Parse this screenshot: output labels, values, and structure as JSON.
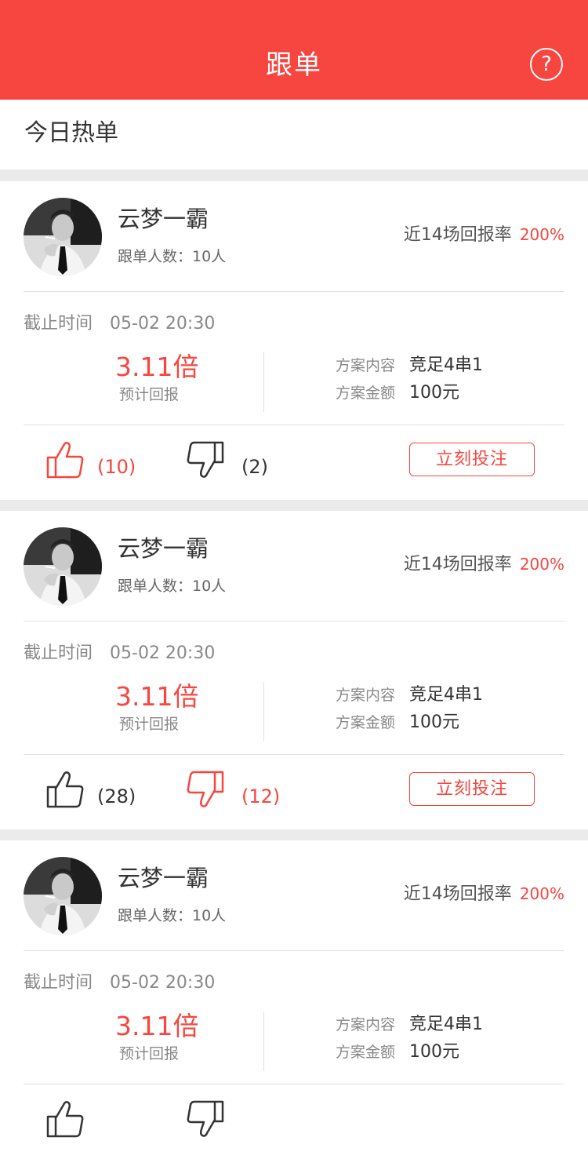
{
  "header": {
    "title": "跟单",
    "help_icon_text": "?"
  },
  "section": {
    "title": "今日热单"
  },
  "cards": [
    {
      "name": "云梦一霸",
      "followers": "跟单人数：10人",
      "rate_label": "近14场回报率",
      "rate_value": "200%",
      "deadline_label": "截止时间",
      "deadline_value": "05-02 20:30",
      "odds": "3.11倍",
      "odds_label": "预计回报",
      "content_label": "方案内容",
      "content_value": "竞足4串1",
      "amount_label": "方案金额",
      "amount_value": "100元",
      "likes": "(10)",
      "dislikes": "(2)",
      "like_active": true,
      "dislike_active": false,
      "bet_label": "立刻投注"
    },
    {
      "name": "云梦一霸",
      "followers": "跟单人数：10人",
      "rate_label": "近14场回报率",
      "rate_value": "200%",
      "deadline_label": "截止时间",
      "deadline_value": "05-02 20:30",
      "odds": "3.11倍",
      "odds_label": "预计回报",
      "content_label": "方案内容",
      "content_value": "竞足4串1",
      "amount_label": "方案金额",
      "amount_value": "100元",
      "likes": "(28)",
      "dislikes": "(12)",
      "like_active": false,
      "dislike_active": true,
      "bet_label": "立刻投注"
    },
    {
      "name": "云梦一霸",
      "followers": "跟单人数：10人",
      "rate_label": "近14场回报率",
      "rate_value": "200%",
      "deadline_label": "截止时间",
      "deadline_value": "05-02 20:30",
      "odds": "3.11倍",
      "odds_label": "预计回报",
      "content_label": "方案内容",
      "content_value": "竞足4串1",
      "amount_label": "方案金额",
      "amount_value": "100元",
      "likes": "",
      "dislikes": "",
      "like_active": false,
      "dislike_active": false,
      "bet_label": ""
    }
  ],
  "colors": {
    "accent": "#f7453f",
    "background": "#ebebeb",
    "text": "#333333",
    "muted": "#888888"
  },
  "icons": {
    "help": "question-circle-icon",
    "like": "thumbs-up-icon",
    "dislike": "thumbs-down-icon",
    "avatar": "user-avatar"
  }
}
